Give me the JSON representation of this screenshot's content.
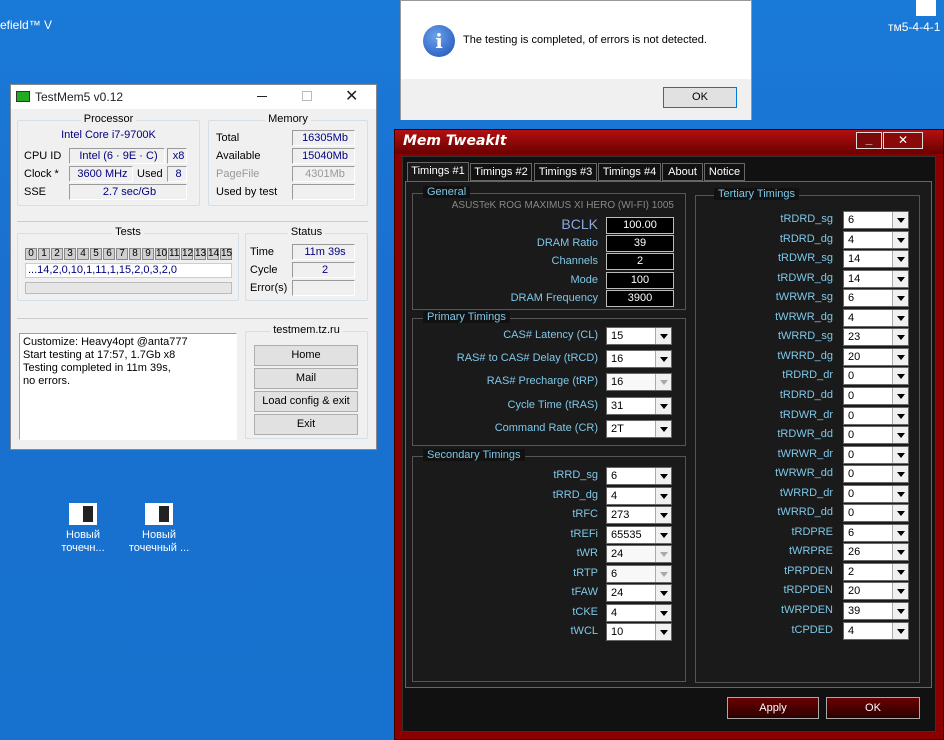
{
  "desktop": {
    "top_left_label": "efield™ V",
    "top_right_label": "тм5-4-4-1",
    "icons": [
      {
        "label_1": "Новый",
        "label_2": "точечн..."
      },
      {
        "label_1": "Новый",
        "label_2": "точечный ..."
      }
    ]
  },
  "msgbox": {
    "message": "The testing is completed, of errors is not detected.",
    "ok": "OK",
    "icon": "info-icon"
  },
  "testmem": {
    "title": "TestMem5 v0.12",
    "processor": {
      "title": "Processor",
      "name": "Intel Core i7-9700K",
      "cpuid_label": "CPU ID",
      "cpuid": "Intel  (6 · 9E · C)",
      "cpuid_x": "x8",
      "clock_label": "Clock *",
      "clock": "3600 MHz",
      "used_label": "Used",
      "used": "8",
      "sse_label": "SSE",
      "sse": "2.7 sec/Gb"
    },
    "memory": {
      "title": "Memory",
      "total_label": "Total",
      "total": "16305Mb",
      "available_label": "Available",
      "available": "15040Mb",
      "pagefile_label": "PageFile",
      "pagefile": "4301Mb",
      "usedbytest_label": "Used by test",
      "usedbytest": ""
    },
    "tests": {
      "title": "Tests",
      "cells": [
        "0",
        "1",
        "2",
        "3",
        "4",
        "5",
        "6",
        "7",
        "8",
        "9",
        "10",
        "11",
        "12",
        "13",
        "14",
        "15"
      ],
      "sequence": "...14,2,0,10,1,11,1,15,2,0,3,2,0"
    },
    "status": {
      "title": "Status",
      "time_label": "Time",
      "time": "11m 39s",
      "cycle_label": "Cycle",
      "cycle": "2",
      "errors_label": "Error(s)",
      "errors": ""
    },
    "log": [
      "Customize: Heavy4opt @anta777",
      "Start testing at 17:57, 1.7Gb x8",
      "Testing completed in 11m 39s,",
      "no errors."
    ],
    "site": "testmem.tz.ru",
    "buttons": {
      "home": "Home",
      "mail": "Mail",
      "load": "Load config & exit",
      "exit": "Exit"
    }
  },
  "tweakit": {
    "title": "Mem TweakIt",
    "tabs": [
      "Timings #1",
      "Timings #2",
      "Timings #3",
      "Timings #4",
      "About",
      "Notice"
    ],
    "general": {
      "caption": "General",
      "board": "ASUSTeK ROG MAXIMUS XI HERO (WI-FI) 1005",
      "rows": [
        {
          "label": "BCLK",
          "value": "100.00"
        },
        {
          "label": "DRAM Ratio",
          "value": "39"
        },
        {
          "label": "Channels",
          "value": "2"
        },
        {
          "label": "Mode",
          "value": "100"
        },
        {
          "label": "DRAM Frequency",
          "value": "3900"
        }
      ]
    },
    "primary": {
      "caption": "Primary Timings",
      "rows": [
        {
          "label": "CAS# Latency (CL)",
          "value": "15"
        },
        {
          "label": "RAS# to CAS# Delay (tRCD)",
          "value": "16"
        },
        {
          "label": "RAS# Precharge (tRP)",
          "value": "16"
        },
        {
          "label": "Cycle Time (tRAS)",
          "value": "31"
        },
        {
          "label": "Command Rate (CR)",
          "value": "2T"
        }
      ]
    },
    "secondary": {
      "caption": "Secondary Timings",
      "rows": [
        {
          "label": "tRRD_sg",
          "value": "6"
        },
        {
          "label": "tRRD_dg",
          "value": "4"
        },
        {
          "label": "tRFC",
          "value": "273"
        },
        {
          "label": "tREFi",
          "value": "65535"
        },
        {
          "label": "tWR",
          "value": "24"
        },
        {
          "label": "tRTP",
          "value": "6"
        },
        {
          "label": "tFAW",
          "value": "24"
        },
        {
          "label": "tCKE",
          "value": "4"
        },
        {
          "label": "tWCL",
          "value": "10"
        }
      ]
    },
    "tertiary": {
      "caption": "Tertiary Timings",
      "rows": [
        {
          "label": "tRDRD_sg",
          "value": "6"
        },
        {
          "label": "tRDRD_dg",
          "value": "4"
        },
        {
          "label": "tRDWR_sg",
          "value": "14"
        },
        {
          "label": "tRDWR_dg",
          "value": "14"
        },
        {
          "label": "tWRWR_sg",
          "value": "6"
        },
        {
          "label": "tWRWR_dg",
          "value": "4"
        },
        {
          "label": "tWRRD_sg",
          "value": "23"
        },
        {
          "label": "tWRRD_dg",
          "value": "20"
        },
        {
          "label": "tRDRD_dr",
          "value": "0"
        },
        {
          "label": "tRDRD_dd",
          "value": "0"
        },
        {
          "label": "tRDWR_dr",
          "value": "0"
        },
        {
          "label": "tRDWR_dd",
          "value": "0"
        },
        {
          "label": "tWRWR_dr",
          "value": "0"
        },
        {
          "label": "tWRWR_dd",
          "value": "0"
        },
        {
          "label": "tWRRD_dr",
          "value": "0"
        },
        {
          "label": "tWRRD_dd",
          "value": "0"
        },
        {
          "label": "tRDPRE",
          "value": "6"
        },
        {
          "label": "tWRPRE",
          "value": "26"
        },
        {
          "label": "tPRPDEN",
          "value": "2"
        },
        {
          "label": "tRDPDEN",
          "value": "20"
        },
        {
          "label": "tWRPDEN",
          "value": "39"
        },
        {
          "label": "tCPDED",
          "value": "4"
        }
      ]
    },
    "apply": "Apply",
    "ok": "OK"
  }
}
